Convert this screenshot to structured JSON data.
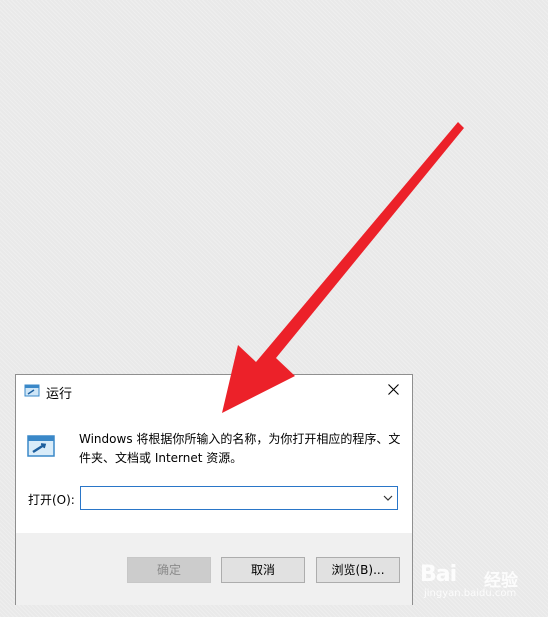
{
  "dialog": {
    "title": "运行",
    "description": "Windows 将根据你所输入的名称，为你打开相应的程序、文件夹、文档或 Internet 资源。",
    "open_label": "打开(O):",
    "open_value": "",
    "buttons": {
      "ok": "确定",
      "cancel": "取消",
      "browse": "浏览(B)..."
    },
    "ok_enabled": false,
    "icons": {
      "title": "run-icon",
      "close": "close-icon",
      "program": "run-program-icon",
      "dropdown": "chevron-down-icon"
    }
  },
  "annotation": {
    "arrow_color": "#ec2129"
  },
  "watermark": {
    "brand": "Bai",
    "jingyan": "经验",
    "url": "jingyan.baidu.com"
  },
  "colors": {
    "background": "#e9e9e9",
    "dialog_bg": "#ffffff",
    "button_bar": "#f0f0f0",
    "input_border": "#2a76c8"
  }
}
